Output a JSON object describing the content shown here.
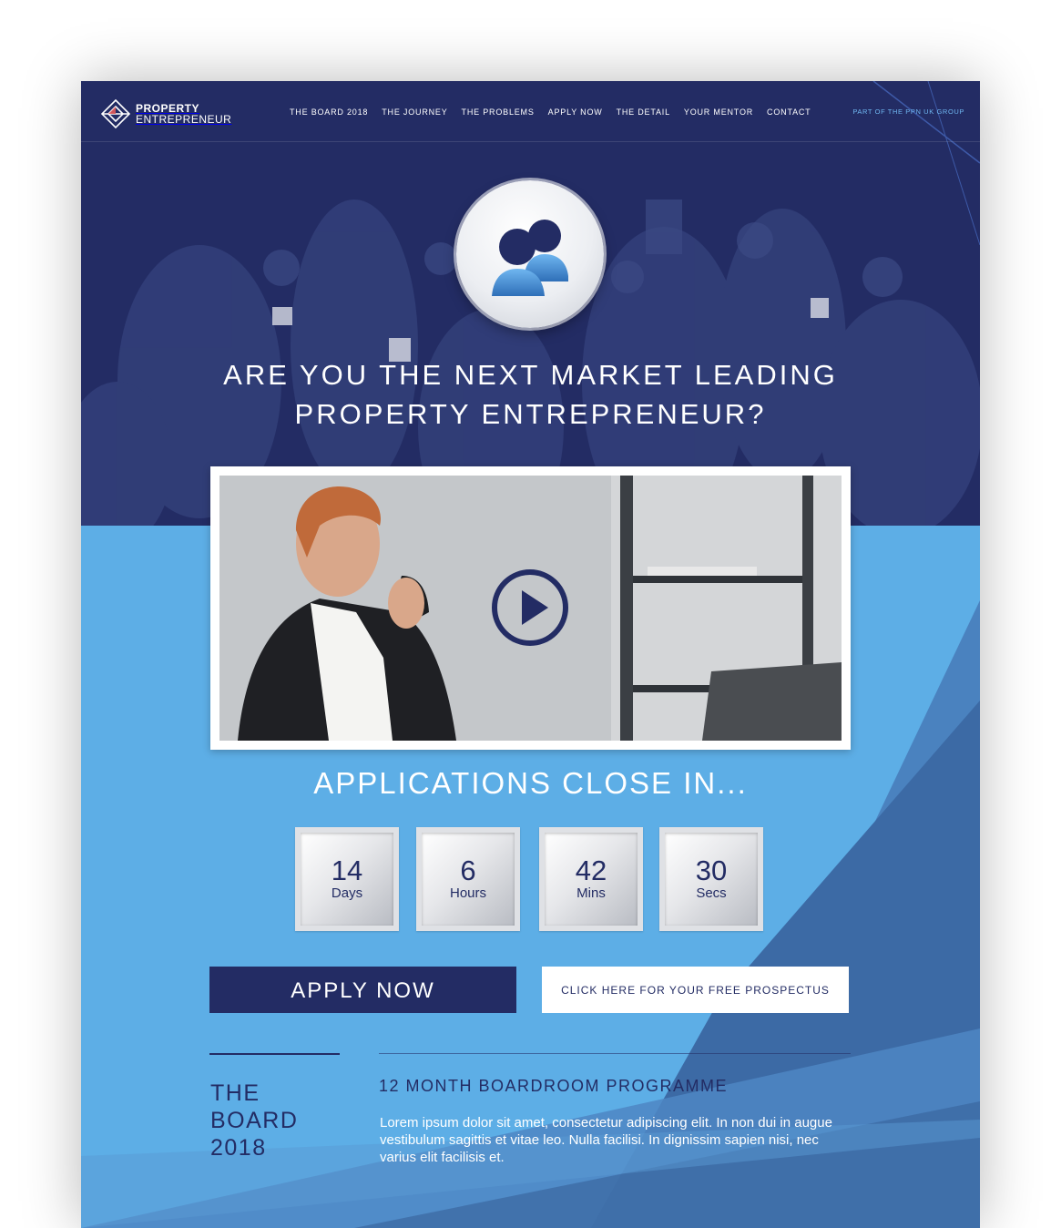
{
  "logo": {
    "line1": "PROPERTY",
    "line2": "ENTREPRENEUR"
  },
  "nav": {
    "items": [
      {
        "label": "THE BOARD 2018"
      },
      {
        "label": "THE JOURNEY"
      },
      {
        "label": "THE PROBLEMS"
      },
      {
        "label": "APPLY NOW"
      },
      {
        "label": "THE DETAIL"
      },
      {
        "label": "YOUR MENTOR"
      },
      {
        "label": "CONTACT"
      }
    ],
    "group_link": "PART OF THE PPN UK GROUP"
  },
  "hero": {
    "icon": "users-icon",
    "title_line1": "ARE YOU THE NEXT MARKET LEADING",
    "title_line2": "PROPERTY ENTREPRENEUR?"
  },
  "video": {
    "icon": "play-icon"
  },
  "countdown": {
    "title": "APPLICATIONS CLOSE IN...",
    "days": {
      "value": "14",
      "unit": "Days"
    },
    "hours": {
      "value": "6",
      "unit": "Hours"
    },
    "mins": {
      "value": "42",
      "unit": "Mins"
    },
    "secs": {
      "value": "30",
      "unit": "Secs"
    }
  },
  "cta": {
    "apply_label": "APPLY NOW",
    "prospectus_label": "CLICK HERE FOR YOUR FREE PROSPECTUS"
  },
  "board": {
    "title_line1": "THE",
    "title_line2": "BOARD",
    "title_line3": "2018",
    "programme_title": "12 MONTH BOARDROOM PROGRAMME",
    "programme_body": "Lorem ipsum dolor sit amet, consectetur adipiscing elit. In non dui in augue vestibulum sagittis et vitae leo. Nulla facilisi. In dignissim sapien nisi, nec varius elit facilisis et."
  },
  "colors": {
    "navy": "#232c64",
    "sky": "#5daee6",
    "deep_blue": "#3d6ea6",
    "white": "#ffffff"
  }
}
